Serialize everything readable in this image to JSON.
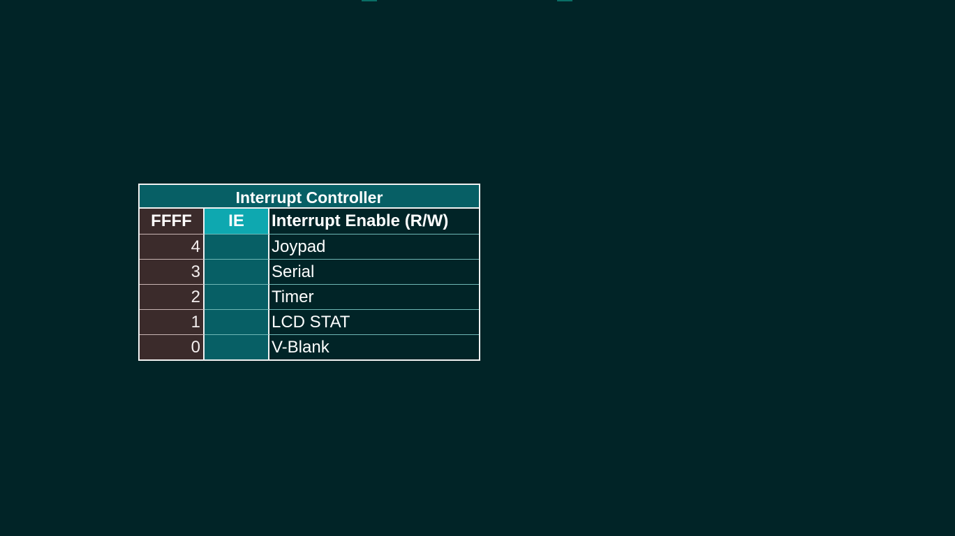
{
  "colors": {
    "background": "#012427",
    "title_bg": "#075f65",
    "ie_header_bg": "#0ea8b0",
    "ie_cell_bg": "#075f65",
    "bit_cell_bg": "#3b2b2b",
    "border": "#f2f2f2"
  },
  "table": {
    "title": "Interrupt Controller",
    "header": {
      "address": "FFFF",
      "register": "IE",
      "description": "Interrupt Enable (R/W)"
    },
    "rows": [
      {
        "bit": "4",
        "label": "Joypad"
      },
      {
        "bit": "3",
        "label": "Serial"
      },
      {
        "bit": "2",
        "label": "Timer"
      },
      {
        "bit": "1",
        "label": "LCD STAT"
      },
      {
        "bit": "0",
        "label": "V-Blank"
      }
    ]
  }
}
